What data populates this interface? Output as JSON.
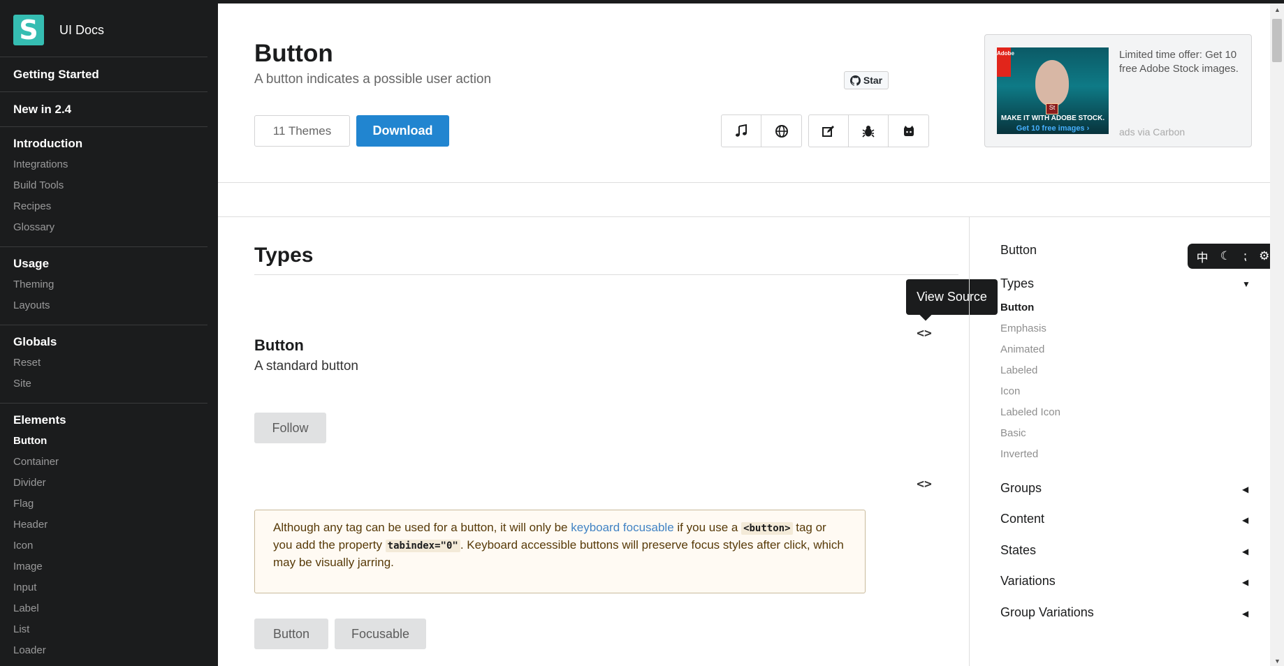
{
  "sidebar": {
    "brand_logo": "S",
    "brand_title": "UI Docs",
    "sections": [
      {
        "head": "Getting Started",
        "items": []
      },
      {
        "head": "New in 2.4",
        "items": []
      },
      {
        "head": "Introduction",
        "items": [
          "Integrations",
          "Build Tools",
          "Recipes",
          "Glossary"
        ]
      },
      {
        "head": "Usage",
        "items": [
          "Theming",
          "Layouts"
        ]
      },
      {
        "head": "Globals",
        "items": [
          "Reset",
          "Site"
        ]
      },
      {
        "head": "Elements",
        "items": [
          "Button",
          "Container",
          "Divider",
          "Flag",
          "Header",
          "Icon",
          "Image",
          "Input",
          "Label",
          "List",
          "Loader"
        ]
      }
    ],
    "active_item": "Button"
  },
  "header": {
    "title": "Button",
    "subtitle": "A button indicates a possible user action",
    "themes_label": "11 Themes",
    "download_label": "Download",
    "star_label": "Star",
    "icons_group1": [
      "music-icon",
      "globe-icon"
    ],
    "icons_group2": [
      "edit-icon",
      "bug-icon",
      "github-alt-icon"
    ]
  },
  "ad": {
    "logo": "Adobe",
    "st": "St",
    "caption1": "MAKE IT WITH ADOBE STOCK.",
    "caption2": "Get 10 free images ›",
    "text": "Limited time offer: Get 10 free Adobe Stock images.",
    "via": "ads via Carbon"
  },
  "content": {
    "section_title": "Types",
    "tooltip": "View Source",
    "example1_title": "Button",
    "example1_desc": "A standard button",
    "follow_label": "Follow",
    "note": {
      "part1": "Although any tag can be used for a button, it will only be ",
      "link": "keyboard focusable",
      "part2": " if you use a ",
      "code1": "<button>",
      "part3": " tag or you add the property ",
      "code2": "tabindex=\"0\"",
      "part4": ". Keyboard accessible buttons will preserve focus styles after click, which may be visually jarring."
    },
    "button_label": "Button",
    "focusable_label": "Focusable"
  },
  "toc": {
    "title": "Button",
    "types_label": "Types",
    "types_items": [
      "Button",
      "Emphasis",
      "Animated",
      "Labeled",
      "Icon",
      "Labeled Icon",
      "Basic",
      "Inverted"
    ],
    "active": "Button",
    "groups": [
      "Groups",
      "Content",
      "States",
      "Variations",
      "Group Variations"
    ]
  },
  "floating_bar": {
    "icons": [
      "中",
      "☾",
      "⁏",
      "⚙"
    ]
  },
  "colors": {
    "sidebar_bg": "#1b1c1d",
    "brand_teal": "#35bdb2",
    "primary_blue": "#2185d0",
    "link_blue": "#4183c4",
    "note_bg": "#fffaf3"
  }
}
